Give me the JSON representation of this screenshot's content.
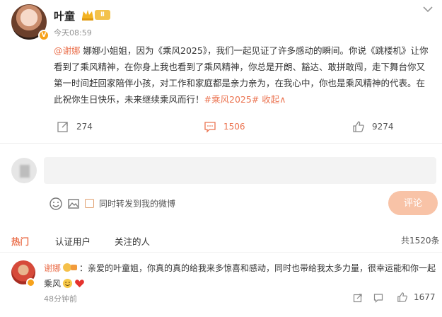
{
  "post": {
    "author": "叶童",
    "level": "Ⅱ",
    "time": "今天08:59",
    "mention": "@谢娜",
    "text": " 娜娜小姐姐，因为《乘风2025》，我们一起见证了许多感动的瞬间。你说《跳楼机》让你看到了乘风精神，在你身上我也看到了乘风精神，你总是开朗、豁达、敢拼敢闯，走下舞台你又第一时间赶回家陪伴小孩，对工作和家庭都是亲力亲为，在我心中，你也是乘风精神的代表。在此祝你生日快乐，未来继续乘风而行！",
    "hashtag": "#乘风2025#",
    "collapse": " 收起∧"
  },
  "actions": {
    "repost_count": "274",
    "comment_count": "1506",
    "like_count": "9274"
  },
  "composer": {
    "placeholder": "",
    "repost_label": "同时转发到我的微博",
    "submit_label": "评论"
  },
  "tabs": {
    "hot": "热门",
    "verified": "认证用户",
    "following": "关注的人",
    "total": "共1520条"
  },
  "comments": [
    {
      "user": "谢娜",
      "text": "：亲爱的叶童姐，你真的真的给我来多惊喜和感动，同时也带给我太多力量，很幸运能和你一起乘风",
      "time": "48分钟前",
      "likes": "1677"
    }
  ],
  "colors": {
    "accent": "#eb7350",
    "vip": "#f7a21b"
  },
  "icons": [
    "more-icon",
    "repost-icon",
    "comment-icon",
    "like-icon",
    "emoji-icon",
    "image-icon",
    "share-icon",
    "reply-icon"
  ]
}
